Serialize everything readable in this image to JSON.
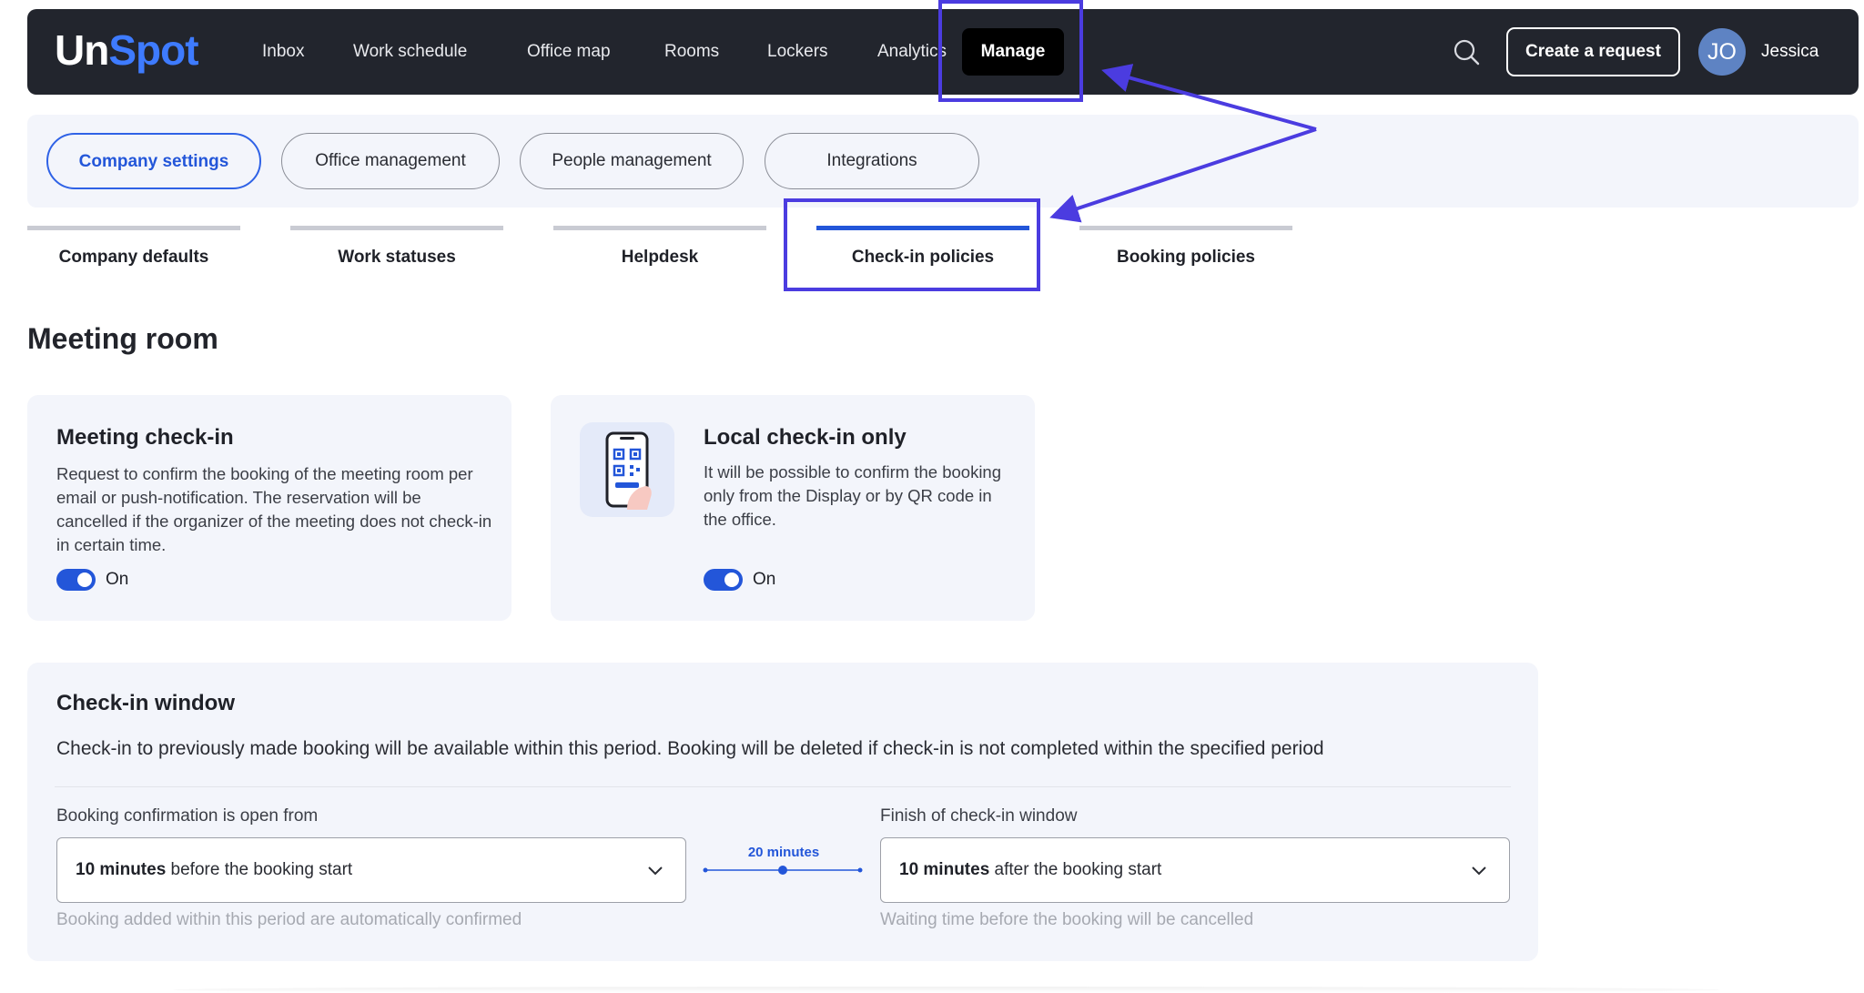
{
  "brand": {
    "part1": "Un",
    "part2": "Spot"
  },
  "nav": {
    "items": [
      "Inbox",
      "Work schedule",
      "Office map",
      "Rooms",
      "Lockers",
      "Analytics"
    ],
    "active": "Manage",
    "create_label": "Create a request",
    "avatar_initials": "JO",
    "user_name": "Jessica"
  },
  "settings_tabs": [
    "Company settings",
    "Office management",
    "People management",
    "Integrations"
  ],
  "sub_tabs": [
    "Company defaults",
    "Work statuses",
    "Helpdesk",
    "Check-in policies",
    "Booking policies"
  ],
  "section_title": "Meeting room",
  "meeting_checkin": {
    "title": "Meeting check-in",
    "description": "Request to confirm the booking of the meeting room per email or push-notification. The reservation will be cancelled if the organizer of the meeting does not check-in in certain time.",
    "toggle_label": "On"
  },
  "local_checkin": {
    "title": "Local check-in only",
    "description": "It will be possible to confirm the booking only from the Display or by QR code in the office.",
    "toggle_label": "On"
  },
  "checkin_window": {
    "title": "Check-in window",
    "description": "Check-in to previously made booking will be available within this period. Booking will be deleted if check-in is not completed within the specified period",
    "open_from": {
      "label": "Booking confirmation is open from",
      "value_bold": "10 minutes",
      "value_rest": " before the booking start",
      "hint": "Booking added within this period are automatically confirmed"
    },
    "range_label": "20 minutes",
    "finish": {
      "label": "Finish of check-in window",
      "value_bold": "10 minutes",
      "value_rest": " after the booking start",
      "hint": "Waiting time before the booking will be cancelled"
    }
  },
  "colors": {
    "accent": "#2356d9",
    "topbar": "#22252d",
    "card": "#f3f5fb",
    "annotation": "#4b3ce0"
  },
  "icons": [
    "search-icon",
    "chevron-down-icon",
    "phone-qr-icon"
  ]
}
